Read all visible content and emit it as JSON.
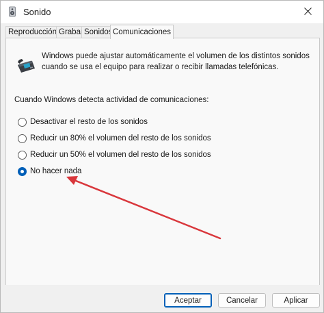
{
  "window": {
    "title": "Sonido",
    "icon": "speaker-icon",
    "close_icon": "close-icon"
  },
  "tabs": [
    {
      "label": "Reproducción",
      "active": false
    },
    {
      "label": "Grabar",
      "active": false
    },
    {
      "label": "Sonidos",
      "active": false
    },
    {
      "label": "Comunicaciones",
      "active": true
    }
  ],
  "communications": {
    "icon": "phone-icon",
    "intro_line1": "Windows puede ajustar automáticamente el volumen de los distintos sonidos",
    "intro_line2": "cuando se usa el equipo para realizar o recibir llamadas telefónicas.",
    "section_label": "Cuando Windows detecta actividad de comunicaciones:",
    "options": [
      {
        "label": "Desactivar el resto de los sonidos",
        "checked": false
      },
      {
        "label": "Reducir un 80% el volumen del resto de los sonidos",
        "checked": false
      },
      {
        "label": "Reducir un 50% el volumen del resto de los sonidos",
        "checked": false
      },
      {
        "label": "No hacer nada",
        "checked": true
      }
    ]
  },
  "buttons": {
    "accept": "Aceptar",
    "cancel": "Cancelar",
    "apply": "Aplicar"
  },
  "colors": {
    "accent": "#005fb8",
    "annotation_arrow": "#d9373c"
  }
}
